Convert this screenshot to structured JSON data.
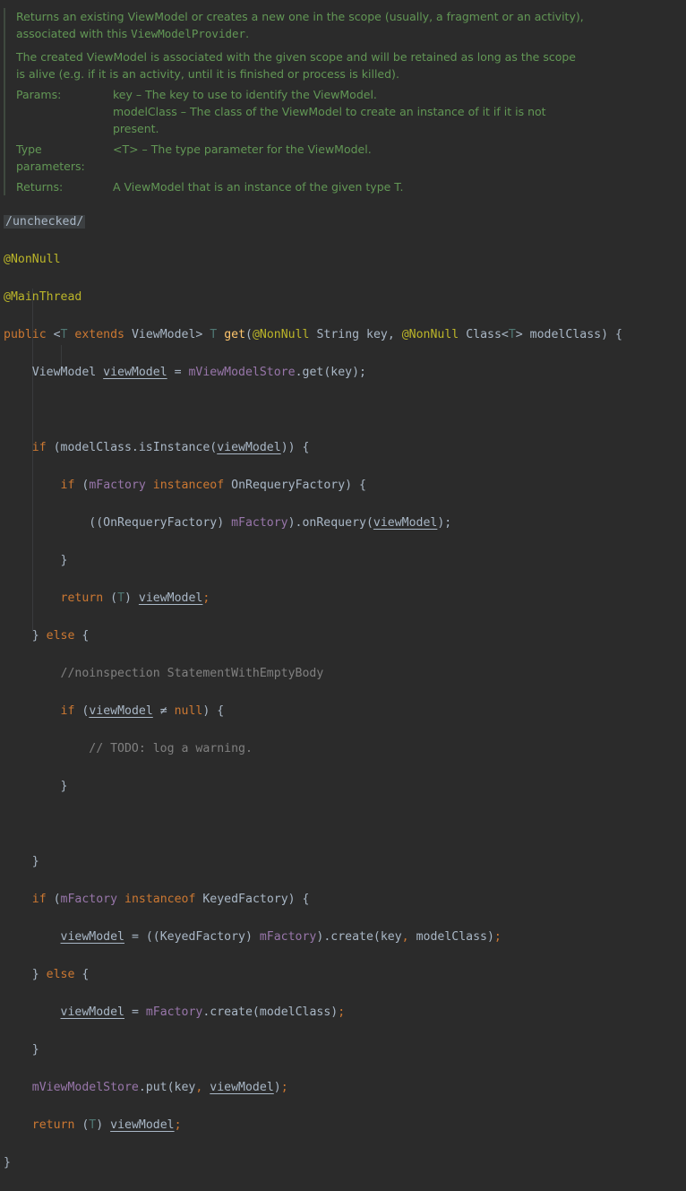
{
  "doc": {
    "para1_a": "Returns an existing ViewModel or creates a new one in the scope (usually, a fragment or an activity),",
    "para1_b": "associated with this ",
    "para1_code": "ViewModelProvider",
    "para1_end": ".",
    "para2_a": "The created ViewModel is associated with the given scope and will be retained as long as the scope",
    "para2_b": "is alive (e.g. if it is an activity, until it is finished or process is killed).",
    "params_label": "Params:",
    "param1": "key – The key to use to identify the ViewModel.",
    "param2_a": "modelClass – The class of the ViewModel to create an instance of it if it is not",
    "param2_b": "present.",
    "type_params_label": "Type parameters:",
    "type_param": "<T> – The type parameter for the ViewModel.",
    "returns_label": "Returns:",
    "returns": "A ViewModel that is an instance of the given type T."
  },
  "code": {
    "unchecked": "/unchecked/",
    "ann_nonnull": "@NonNull",
    "ann_mainthread": "@MainThread",
    "kw_public": "public",
    "lt": " <",
    "type_T": "T",
    "kw_extends": " extends",
    "vm_gt": " ViewModel> ",
    "method_get": "get",
    "paren_open": "(",
    "ann_nonnull2": "@NonNull",
    "string_key": " String key, ",
    "ann_nonnull3": "@NonNull",
    "class_lt": " Class<",
    "gt_model": "> modelClass) {",
    "l5_type": "ViewModel ",
    "var_viewModel": "viewModel",
    "eq": " = ",
    "field_store": "mViewModelStore",
    "l5_rest": ".get(key);",
    "kw_if": "if",
    "l7_a": " (modelClass.isInstance(",
    "l7_b": ")) {",
    "l8_a": " (",
    "field_factory": "mFactory",
    "kw_instanceof": " instanceof",
    "l8_b": " OnRequeryFactory) {",
    "l9_a": "((OnRequeryFactory) ",
    "l9_b": ").onRequery(",
    "l9_c": ");",
    "brace_close": "}",
    "kw_return": "return",
    "l11_a": " (",
    "l11_b": ") ",
    "semicolon": ";",
    "kw_else": "else",
    "l12_open": "} ",
    "l12_close": " {",
    "comment_noinspection": "//noinspection StatementWithEmptyBody",
    "l14_a": " (",
    "neq": " ≠ ",
    "kw_null": "null",
    "l14_b": ") {",
    "comment_todo": "// TODO: log a warning.",
    "l18_b": " KeyedFactory) {",
    "l19_a": " = ((KeyedFactory) ",
    "l19_b": ").create(key",
    "comma": ",",
    "l19_c": " modelClass)",
    "l21_a": " = ",
    "l21_b": ".create(modelClass)",
    "l23_b": ".put(key",
    "l23_c": " ",
    "l23_d": ")",
    "l24_a": " (",
    "l24_b": ") "
  }
}
